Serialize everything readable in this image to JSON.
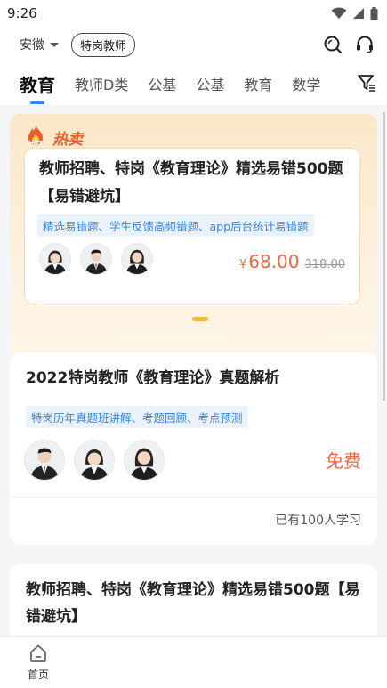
{
  "status_bar": {
    "time": "9:26"
  },
  "top_bar": {
    "region": "安徽",
    "category": "特岗教师"
  },
  "tabs": [
    {
      "label": "教育",
      "active": true
    },
    {
      "label": "教师D类",
      "active": false
    },
    {
      "label": "公基",
      "active": false
    },
    {
      "label": "公基",
      "active": false
    },
    {
      "label": "教育",
      "active": false
    },
    {
      "label": "数学",
      "active": false
    }
  ],
  "hot_section": {
    "badge_text": "HOT",
    "title": "热卖",
    "course": {
      "title": "教师招聘、特岗《教育理论》精选易错500题【易错避坑】",
      "tag": "精选易错题、学生反馈高频错题、app后台统计易错题",
      "currency": "¥",
      "price": "68.00",
      "original_price": "318.00",
      "teachers": [
        "female",
        "male",
        "female"
      ]
    }
  },
  "courses": [
    {
      "title": "2022特岗教师《教育理论》真题解析",
      "tag": "特岗历年真题班讲解、考题回顾、考点预测",
      "price_label": "免费",
      "learners": "已有100人学习",
      "teachers": [
        "male",
        "female",
        "female"
      ]
    },
    {
      "title": "教师招聘、特岗《教育理论》精选易错500题【易错避坑】"
    }
  ],
  "bottom_nav": {
    "home_label": "首页"
  },
  "colors": {
    "accent": "#2a8cf0",
    "price": "#f0653f",
    "hot": "#e8602c",
    "tag_text": "#3d86d6",
    "dot": "#f4b63c"
  },
  "icons": [
    "wifi-icon",
    "signal-icon",
    "battery-icon",
    "search-icon",
    "headset-icon",
    "filter-icon",
    "flame-icon",
    "home-icon"
  ]
}
